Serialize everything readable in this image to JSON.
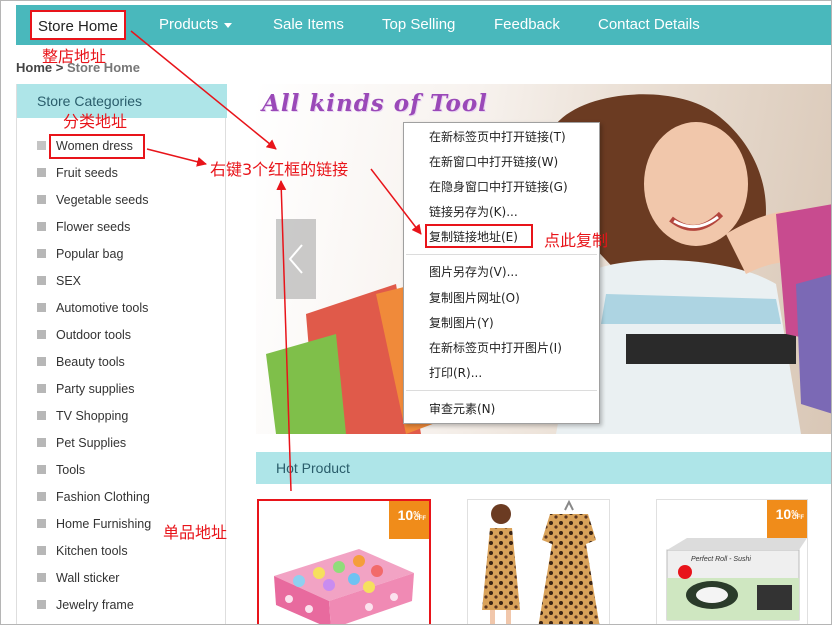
{
  "nav": {
    "home": "Store Home",
    "items": [
      "Products",
      "Sale Items",
      "Top Selling",
      "Feedback",
      "Contact Details"
    ]
  },
  "breadcrumb": {
    "home": "Home",
    "sep": ">",
    "current": "Store Home"
  },
  "sidebar": {
    "title": "Store Categories",
    "categories": [
      "Women dress",
      "Fruit seeds",
      "Vegetable seeds",
      "Flower seeds",
      "Popular bag",
      "SEX",
      "Automotive tools",
      "Outdoor tools",
      "Beauty tools",
      "Party supplies",
      "TV Shopping",
      "Pet Supplies",
      "Tools",
      "Fashion Clothing",
      "Home Furnishing",
      "Kitchen tools",
      "Wall sticker",
      "Jewelry frame"
    ]
  },
  "banner": {
    "title": "All kinds of Tool"
  },
  "context_menu": {
    "items": [
      "在新标签页中打开链接(T)",
      "在新窗口中打开链接(W)",
      "在隐身窗口中打开链接(G)",
      "链接另存为(K)...",
      "复制链接地址(E)",
      "图片另存为(V)...",
      "复制图片网址(O)",
      "复制图片(Y)",
      "在新标签页中打开图片(I)",
      "打印(R)...",
      "审查元素(N)"
    ]
  },
  "hot_product": {
    "title": "Hot Product",
    "badge_pct": "10",
    "badge_unit": "%",
    "badge_off": "OFF",
    "roll_sushi_label": "Perfect Roll - Sushi"
  },
  "annotations": {
    "store_url": "整店地址",
    "category_url": "分类地址",
    "right_click": "右键3个红框的链接",
    "click_copy": "点此复制",
    "item_url": "单品地址"
  },
  "colors": {
    "nav_bg": "#49b8bc",
    "section_bg": "#aee5e8",
    "annotation": "#e8141a",
    "badge": "#f08c1a"
  }
}
